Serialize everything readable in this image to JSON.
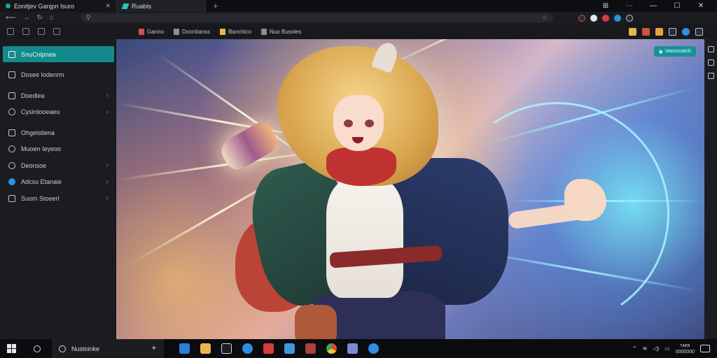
{
  "tabs": [
    {
      "title": "Eonitjev Ganjpn Isuro",
      "active": false
    },
    {
      "title": "Ruabis",
      "active": true
    }
  ],
  "window_controls": [
    "⊞",
    "⋯",
    "—",
    "☐",
    "✕"
  ],
  "address_bar": {
    "value": ""
  },
  "bookmarks": [
    "Ganno",
    "Doonitanss",
    "Banchico",
    "Nuo Busoles"
  ],
  "sidebar": {
    "items": [
      {
        "label": "SnuCnipnea",
        "icon": "home-icon",
        "active": true,
        "chevron": false
      },
      {
        "label": "Dosee Iodenrm",
        "icon": "inbox-icon",
        "active": false,
        "chevron": false
      },
      {
        "label": "Doedlea",
        "icon": "chat-icon",
        "active": false,
        "chevron": true
      },
      {
        "label": "Cysirdooeaeu",
        "icon": "circle-icon",
        "active": false,
        "chevron": true
      },
      {
        "label": "Ohgeistiena",
        "icon": "folder-icon",
        "active": false,
        "chevron": false
      },
      {
        "label": "Muoen Ieyeoo",
        "icon": "pin-icon",
        "active": false,
        "chevron": false
      },
      {
        "label": "Deonsoe",
        "icon": "cloud-icon",
        "active": false,
        "chevron": true
      },
      {
        "label": "Adcsu Etanaie",
        "icon": "globe-icon",
        "active": false,
        "chevron": true
      },
      {
        "label": "Suom Stoeerl",
        "icon": "settings-icon",
        "active": false,
        "chevron": true
      }
    ]
  },
  "viewer": {
    "badge": "Vaeoonatnh"
  },
  "taskbar": {
    "search_text": "Nustoinke",
    "apps": [
      {
        "name": "store",
        "color": "#2a7fd6"
      },
      {
        "name": "file-explorer",
        "color": "#e8b64a"
      },
      {
        "name": "media",
        "color": "#d7d9de"
      },
      {
        "name": "browser-edge",
        "color": "#2d8ee0"
      },
      {
        "name": "security",
        "color": "#d23f3f"
      },
      {
        "name": "photos",
        "color": "#3a9ad9"
      },
      {
        "name": "app-red",
        "color": "#a8423a"
      },
      {
        "name": "chrome",
        "color": "#f2c531"
      },
      {
        "name": "monitor",
        "color": "#7d8bd6"
      },
      {
        "name": "chat",
        "color": "#2f8fe0"
      }
    ],
    "clock_time": "ᴛᴀᴇʀ",
    "clock_date": "0000000"
  }
}
